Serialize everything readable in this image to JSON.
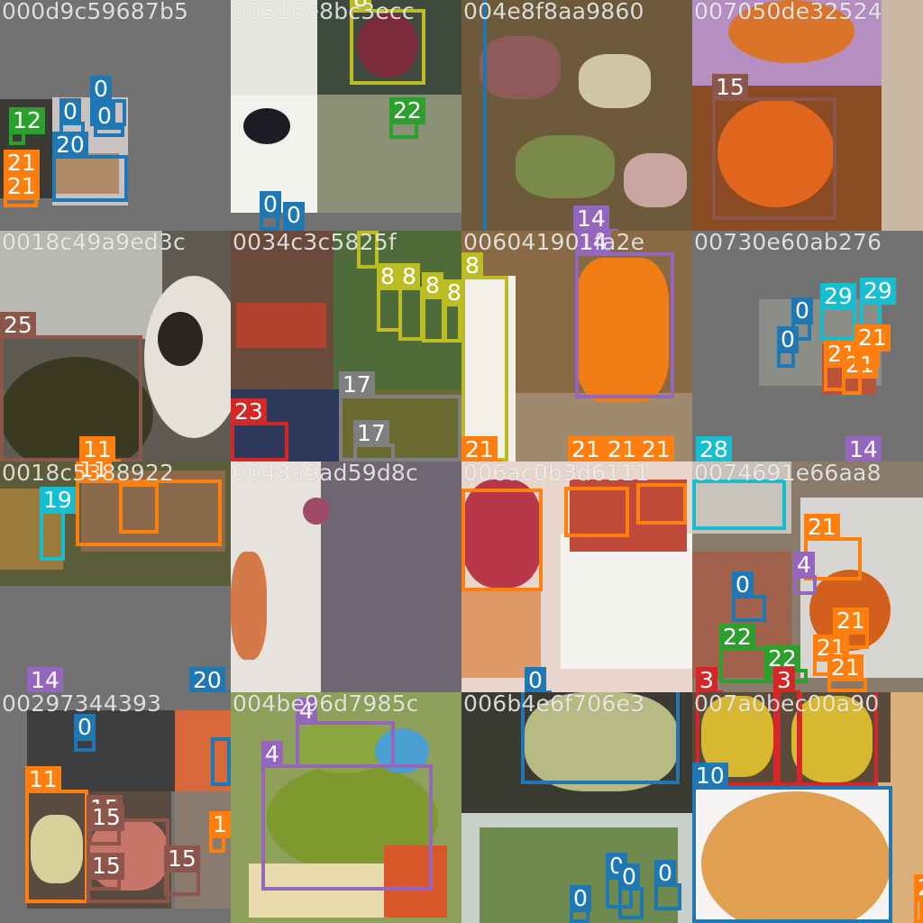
{
  "colors": {
    "0": "#1f77b4",
    "3": "#d62728",
    "4": "#9467bd",
    "8": "#bcbd22",
    "10": "#1f77b4",
    "11": "#ff7f0e",
    "12": "#2ca02c",
    "14": "#9467bd",
    "15": "#8c564b",
    "17": "#7f7f7f",
    "19": "#17becf",
    "20": "#1f77b4",
    "21": "#ff7f0e",
    "22": "#2ca02c",
    "23": "#d62728",
    "25": "#8c564b",
    "28": "#17becf",
    "29": "#17becf"
  },
  "tiles": [
    {
      "id": "000d9c59687b5",
      "bg": "#727272",
      "labels": [
        "0",
        "0",
        "0",
        "12",
        "20",
        "21",
        "21"
      ]
    },
    {
      "id": "00316e8bc3ecc",
      "bg": "#d9d3cc",
      "labels": [
        "8",
        "22",
        "0",
        "0"
      ]
    },
    {
      "id": "004e8f8aa9860",
      "bg": "#6d5a3a",
      "labels": [
        "14"
      ]
    },
    {
      "id": "007050de32524",
      "bg": "#8a4a22",
      "labels": [
        "15"
      ]
    },
    {
      "id": "0018c49a9ed3c",
      "bg": "#5e5c52",
      "labels": [
        "25",
        "11"
      ]
    },
    {
      "id": "0034c3c5825f",
      "bg": "#4f6b3a",
      "labels": [
        "8",
        "8",
        "8",
        "8",
        "8",
        "17",
        "17",
        "23"
      ]
    },
    {
      "id": "006041901fa2e",
      "bg": "#8a6a44",
      "labels": [
        "8",
        "14",
        "21",
        "21",
        "21",
        "21"
      ]
    },
    {
      "id": "00730e60ab276",
      "bg": "#727272",
      "labels": [
        "0",
        "0",
        "29",
        "29",
        "21",
        "21",
        "21",
        "28",
        "14"
      ]
    },
    {
      "id": "0018c5388922",
      "bg": "#727272",
      "labels": [
        "19",
        "11",
        "14",
        "20"
      ]
    },
    {
      "id": "0048a9ad59d8c",
      "bg": "#6e6670",
      "labels": []
    },
    {
      "id": "006ac0b3d6111",
      "bg": "#e8d6cc",
      "labels": [
        "0"
      ]
    },
    {
      "id": "0074691e66aa8",
      "bg": "#8a7a6a",
      "labels": [
        "21",
        "4",
        "0",
        "21",
        "22",
        "22",
        "21",
        "21",
        "3",
        "3"
      ]
    },
    {
      "id": "00297344393",
      "bg": "#727272",
      "labels": [
        "0",
        "11",
        "15",
        "15",
        "15",
        "15",
        "1"
      ]
    },
    {
      "id": "004be96d7985c",
      "bg": "#8ea05a",
      "labels": [
        "4",
        "4"
      ]
    },
    {
      "id": "006b4e6f706e3",
      "bg": "#3a3a33",
      "labels": [
        "0",
        "0",
        "0",
        "0"
      ]
    },
    {
      "id": "007a0bec00a90",
      "bg": "#d9b07a",
      "labels": [
        "10",
        "2"
      ]
    }
  ]
}
